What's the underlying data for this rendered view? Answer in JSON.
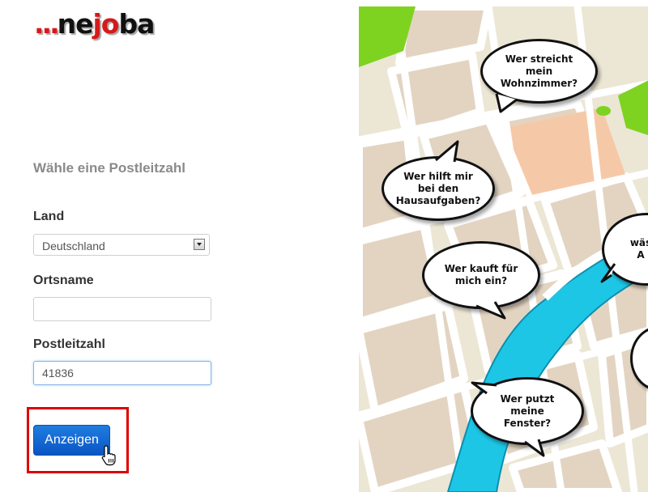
{
  "logo": {
    "dots": "...",
    "ne": "ne",
    "jo": "jo",
    "ba": "ba"
  },
  "form": {
    "title": "Wähle eine Postleitzahl",
    "country_label": "Land",
    "country_value": "Deutschland",
    "city_label": "Ortsname",
    "city_value": "",
    "zip_label": "Postleitzahl",
    "zip_value": "41836",
    "submit_label": "Anzeigen"
  },
  "map": {
    "bubbles": [
      "Wer streicht mein Wohnzimmer?",
      "Wer hilft mir bei den Hausaufgaben?",
      "Wer kauft für mich ein?",
      "Wer putzt meine Fenster?",
      "wäs A",
      ""
    ]
  },
  "colors": {
    "logo_red": "#d61a1a",
    "button_blue": "#0a55c3",
    "highlight_red": "#e00000",
    "map_land": "#ece6d5",
    "map_road": "#ffffff",
    "map_block": "#e3d4c2",
    "map_water": "#1ec6e6",
    "map_park": "#7ed321",
    "map_sand": "#f5c9a8"
  },
  "icons": {
    "dropdown": "chevron-down-icon",
    "cursor": "hand-pointer-icon"
  }
}
